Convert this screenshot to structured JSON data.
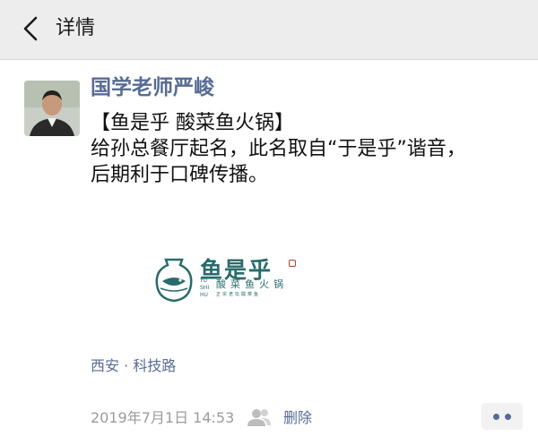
{
  "nav": {
    "title": "详情",
    "back_icon": "chevron-left-icon"
  },
  "post": {
    "author": "国学老师严峻",
    "lines": [
      "【鱼是乎 酸菜鱼火锅】",
      "给孙总餐厅起名，此名取自“于是乎”谐音，",
      "后期利于口碑传播。"
    ],
    "image": {
      "brand": "鱼是乎",
      "brand_en": [
        "YU",
        "SHI",
        "HU"
      ],
      "tagline": "酸菜鱼火锅",
      "small_text": "正宗老坛酸菜鱼"
    },
    "location": "西安 · 科技路",
    "time": "2019年7月1日 14:53",
    "delete_label": "删除"
  },
  "colors": {
    "link": "#576b95",
    "nav_bg": "#ededed",
    "logo": "#2a6b6b"
  }
}
